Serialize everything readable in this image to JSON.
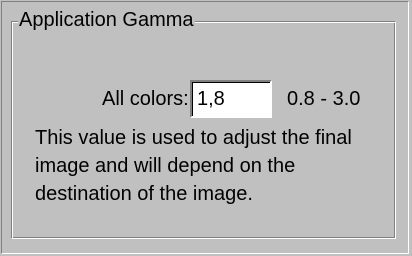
{
  "group": {
    "title": "Application Gamma"
  },
  "gamma": {
    "label": "All colors:",
    "value": "1,8",
    "range": "0.8 - 3.0"
  },
  "description": "This value is used to adjust the final image and will depend on the destination of the image."
}
